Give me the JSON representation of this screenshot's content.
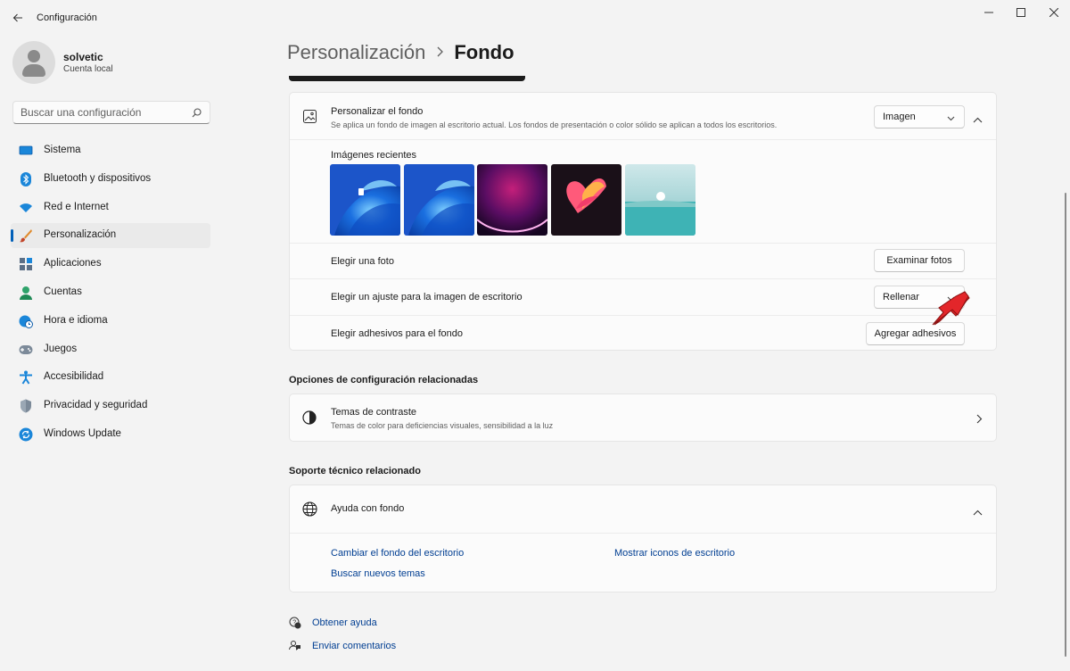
{
  "window": {
    "title": "Configuración",
    "controls": [
      "minimize-icon",
      "maximize-icon",
      "close-icon"
    ]
  },
  "profile": {
    "name": "solvetic",
    "account_type": "Cuenta local"
  },
  "search": {
    "placeholder": "Buscar una configuración"
  },
  "sidebar": {
    "selected": "Personalización",
    "items": [
      {
        "label": "Sistema",
        "icon": "monitor-icon"
      },
      {
        "label": "Bluetooth y dispositivos",
        "icon": "bluetooth-icon"
      },
      {
        "label": "Red e Internet",
        "icon": "wifi-icon"
      },
      {
        "label": "Personalización",
        "icon": "brush-icon"
      },
      {
        "label": "Aplicaciones",
        "icon": "apps-icon"
      },
      {
        "label": "Cuentas",
        "icon": "account-icon"
      },
      {
        "label": "Hora e idioma",
        "icon": "globe-clock-icon"
      },
      {
        "label": "Juegos",
        "icon": "gamepad-icon"
      },
      {
        "label": "Accesibilidad",
        "icon": "accessibility-icon"
      },
      {
        "label": "Privacidad y seguridad",
        "icon": "shield-icon"
      },
      {
        "label": "Windows Update",
        "icon": "update-icon"
      }
    ]
  },
  "breadcrumb": {
    "parent": "Personalización",
    "current": "Fondo"
  },
  "background": {
    "title": "Personalizar el fondo",
    "description": "Se aplica un fondo de imagen al escritorio actual. Los fondos de presentación o color sólido se aplican a todos los escritorios.",
    "type_value": "Imagen",
    "recent_images_label": "Imágenes recientes",
    "recent_images": [
      "windows-bloom-blue-locked",
      "windows-bloom-blue",
      "purple-glow",
      "colorful-flower",
      "turquoise-lake"
    ],
    "choose_photo_label": "Elegir una foto",
    "browse_button": "Examinar fotos",
    "fit_label": "Elegir un ajuste para la imagen de escritorio",
    "fit_value": "Rellenar",
    "stickers_label": "Elegir adhesivos para el fondo",
    "stickers_button": "Agregar adhesivos",
    "accent": "#e3262a"
  },
  "related": {
    "heading": "Opciones de configuración relacionadas",
    "contrast_title": "Temas de contraste",
    "contrast_sub": "Temas de color para deficiencias visuales, sensibilidad a la luz"
  },
  "support": {
    "heading": "Soporte técnico relacionado",
    "help_title": "Ayuda con fondo",
    "links": [
      "Cambiar el fondo del escritorio",
      "Mostrar iconos de escritorio",
      "Buscar nuevos temas"
    ]
  },
  "footer": {
    "get_help": "Obtener ayuda",
    "feedback": "Enviar comentarios"
  }
}
